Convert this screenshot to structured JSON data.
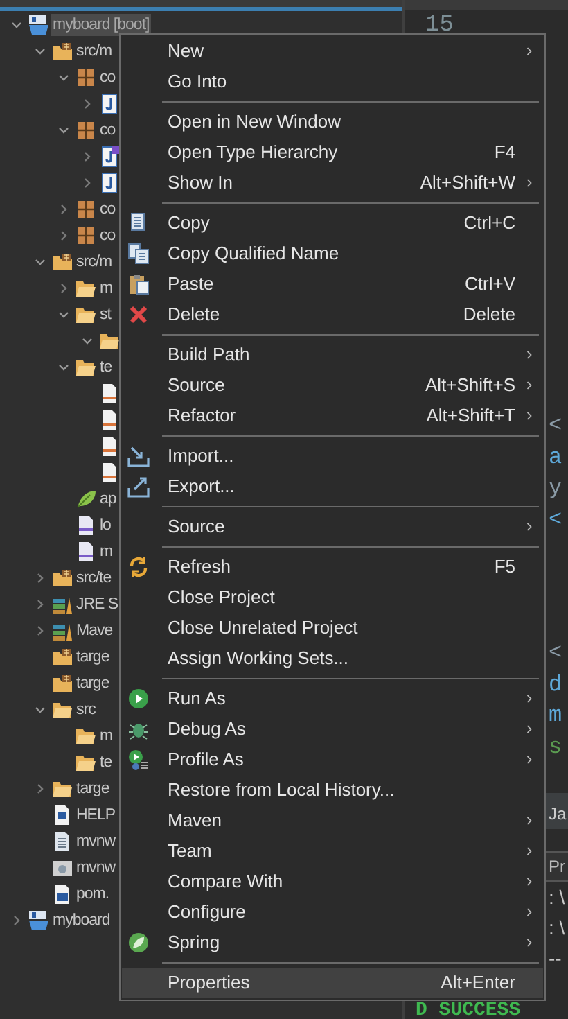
{
  "tree": [
    {
      "label": "myboard [boot]",
      "kind": "project",
      "expanded": true,
      "selected": true,
      "children": [
        {
          "label": "src/m",
          "kind": "sourcefolder",
          "expanded": true,
          "children": [
            {
              "label": "co",
              "kind": "package",
              "expanded": true,
              "children": [
                {
                  "kind": "java",
                  "expanded": false
                }
              ]
            },
            {
              "label": "co",
              "kind": "package",
              "expanded": true,
              "children": [
                {
                  "kind": "interface",
                  "expanded": false
                },
                {
                  "kind": "java",
                  "expanded": false
                }
              ]
            },
            {
              "label": "co",
              "kind": "package",
              "expanded": false
            },
            {
              "label": "co",
              "kind": "package",
              "expanded": false
            }
          ]
        },
        {
          "label": "src/m",
          "kind": "sourcefolder",
          "expanded": true,
          "children": [
            {
              "label": "m",
              "kind": "folder",
              "expanded": false
            },
            {
              "label": "st",
              "kind": "folder",
              "expanded": true,
              "children": [
                {
                  "kind": "folder",
                  "expanded": true
                }
              ]
            },
            {
              "label": "te",
              "kind": "folder",
              "expanded": true,
              "children": [
                {
                  "kind": "html"
                },
                {
                  "kind": "html"
                },
                {
                  "kind": "html"
                },
                {
                  "kind": "html"
                }
              ]
            },
            {
              "label": "ap",
              "kind": "leaf"
            },
            {
              "label": "lo",
              "kind": "xml"
            },
            {
              "label": "m",
              "kind": "xml"
            }
          ]
        },
        {
          "label": "src/te",
          "kind": "sourcefolder",
          "expanded": false
        },
        {
          "label": "JRE S",
          "kind": "library",
          "expanded": false
        },
        {
          "label": "Mave",
          "kind": "library",
          "expanded": false
        },
        {
          "label": "targe",
          "kind": "sourcefolder"
        },
        {
          "label": "targe",
          "kind": "sourcefolder"
        },
        {
          "label": "src",
          "kind": "folder",
          "expanded": true,
          "children": [
            {
              "label": "m",
              "kind": "folder"
            },
            {
              "label": "te",
              "kind": "folder"
            }
          ]
        },
        {
          "label": "targe",
          "kind": "folder",
          "expanded": false
        },
        {
          "label": "HELP",
          "kind": "word"
        },
        {
          "label": "mvnw",
          "kind": "text"
        },
        {
          "label": "mvnw",
          "kind": "script"
        },
        {
          "label": "pom.",
          "kind": "maven"
        }
      ]
    },
    {
      "label": "myboard",
      "kind": "project",
      "expanded": false,
      "selected": false
    }
  ],
  "editor": {
    "line_number": "15",
    "code_top": [
      {
        "text": "<",
        "kind": "markup"
      },
      {
        "text": "a",
        "kind": "name"
      },
      {
        "text": "y",
        "kind": "markup"
      },
      {
        "text": "<",
        "kind": "name"
      }
    ],
    "code_bottom": [
      {
        "text": "<",
        "kind": "markup"
      },
      {
        "text": "d",
        "kind": "name"
      },
      {
        "text": "m",
        "kind": "name"
      },
      {
        "text": "s",
        "kind": "string"
      }
    ]
  },
  "bottom_tab": "Ja",
  "console": {
    "header": "Pr",
    "lines": [
      ": \\",
      ": \\",
      "--"
    ],
    "status": "D SUCCESS"
  },
  "menu": [
    {
      "kind": "plain",
      "label": "New",
      "submenu": true
    },
    {
      "kind": "plain",
      "label": "Go Into"
    },
    {
      "kind": "separator"
    },
    {
      "kind": "plain",
      "label": "Open in New Window"
    },
    {
      "kind": "plain",
      "label": "Open Type Hierarchy",
      "shortcut": "F4"
    },
    {
      "kind": "plain",
      "label": "Show In",
      "shortcut": "Alt+Shift+W",
      "submenu": true
    },
    {
      "kind": "separator"
    },
    {
      "kind": "copy",
      "label": "Copy",
      "shortcut": "Ctrl+C"
    },
    {
      "kind": "qualified",
      "label": "Copy Qualified Name"
    },
    {
      "kind": "paste",
      "label": "Paste",
      "shortcut": "Ctrl+V"
    },
    {
      "kind": "delete",
      "label": "Delete",
      "shortcut": "Delete"
    },
    {
      "kind": "separator"
    },
    {
      "kind": "plain",
      "label": "Build Path",
      "submenu": true
    },
    {
      "kind": "plain",
      "label": "Source",
      "shortcut": "Alt+Shift+S",
      "submenu": true
    },
    {
      "kind": "plain",
      "label": "Refactor",
      "shortcut": "Alt+Shift+T",
      "submenu": true
    },
    {
      "kind": "separator"
    },
    {
      "kind": "import",
      "label": "Import..."
    },
    {
      "kind": "export",
      "label": "Export..."
    },
    {
      "kind": "separator"
    },
    {
      "kind": "plain",
      "label": "Source",
      "submenu": true
    },
    {
      "kind": "separator"
    },
    {
      "kind": "refresh",
      "label": "Refresh",
      "shortcut": "F5"
    },
    {
      "kind": "plain",
      "label": "Close Project"
    },
    {
      "kind": "plain",
      "label": "Close Unrelated Project"
    },
    {
      "kind": "plain",
      "label": "Assign Working Sets..."
    },
    {
      "kind": "separator"
    },
    {
      "kind": "run",
      "label": "Run As",
      "submenu": true
    },
    {
      "kind": "debug",
      "label": "Debug As",
      "submenu": true
    },
    {
      "kind": "profile",
      "label": "Profile As",
      "submenu": true
    },
    {
      "kind": "plain",
      "label": "Restore from Local History..."
    },
    {
      "kind": "plain",
      "label": "Maven",
      "submenu": true
    },
    {
      "kind": "plain",
      "label": "Team",
      "submenu": true
    },
    {
      "kind": "plain",
      "label": "Compare With",
      "submenu": true
    },
    {
      "kind": "plain",
      "label": "Configure",
      "submenu": true
    },
    {
      "kind": "spring",
      "label": "Spring",
      "submenu": true
    },
    {
      "kind": "separator"
    },
    {
      "kind": "plain",
      "label": "Properties",
      "shortcut": "Alt+Enter",
      "highlighted": true
    }
  ]
}
